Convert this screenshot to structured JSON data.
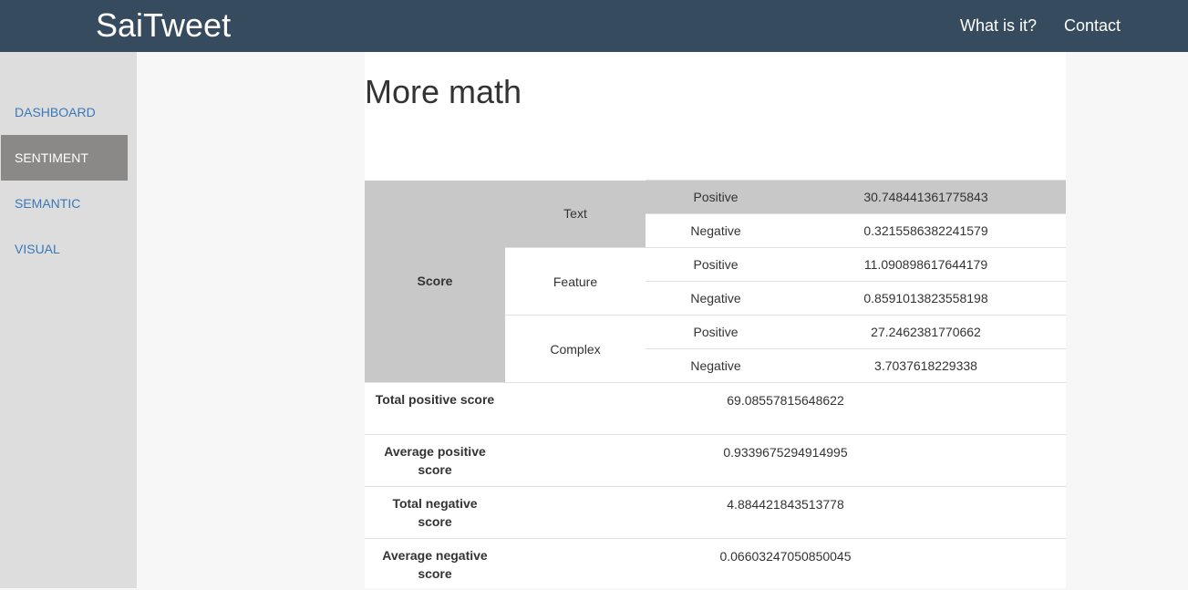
{
  "navbar": {
    "brand": "SaiTweet",
    "links": [
      "What is it?",
      "Contact"
    ]
  },
  "sidebar": {
    "items": [
      {
        "label": "DASHBOARD",
        "active": false
      },
      {
        "label": "SENTIMENT",
        "active": true
      },
      {
        "label": "SEMANTIC",
        "active": false
      },
      {
        "label": "VISUAL",
        "active": false
      }
    ]
  },
  "main": {
    "title": "More math",
    "table": {
      "score_label": "Score",
      "groups": [
        {
          "name": "Text",
          "rows": [
            {
              "polarity": "Positive",
              "value": "30.748441361775843"
            },
            {
              "polarity": "Negative",
              "value": "0.3215586382241579"
            }
          ]
        },
        {
          "name": "Feature",
          "rows": [
            {
              "polarity": "Positive",
              "value": "11.090898617644179"
            },
            {
              "polarity": "Negative",
              "value": "0.8591013823558198"
            }
          ]
        },
        {
          "name": "Complex",
          "rows": [
            {
              "polarity": "Positive",
              "value": "27.2462381770662"
            },
            {
              "polarity": "Negative",
              "value": "3.7037618229338"
            }
          ]
        }
      ],
      "summary": [
        {
          "label": "Total positive score",
          "value": "69.08557815648622"
        },
        {
          "label": "Average positive score",
          "value": "0.9339675294914995"
        },
        {
          "label": "Total negative score",
          "value": "4.884421843513778"
        },
        {
          "label": "Average negative score",
          "value": "0.06603247050850045"
        }
      ]
    }
  },
  "colors": {
    "navbar_bg": "#364b5e",
    "sidebar_bg": "#dddddd",
    "sidebar_active_bg": "#8a8987",
    "link": "#3a78b8",
    "table_header_grey": "#c8c8c8"
  }
}
